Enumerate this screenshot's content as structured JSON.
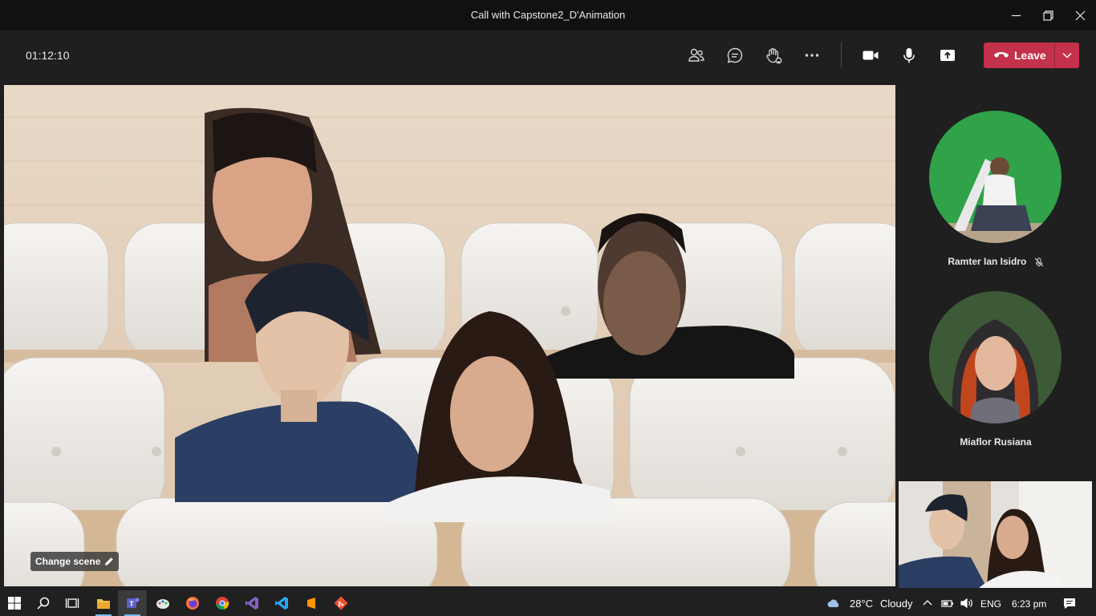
{
  "window": {
    "title": "Call with Capstone2_D'Animation",
    "controls": [
      "minimize-icon",
      "restore-icon",
      "close-icon"
    ]
  },
  "toolbar": {
    "timer": "01:12:10",
    "buttons": [
      "people-icon",
      "chat-icon",
      "raise-hand-icon",
      "more-options-icon",
      "camera-icon",
      "microphone-icon",
      "share-screen-icon"
    ],
    "leave_label": "Leave",
    "leave_color": "#c4314b"
  },
  "stage": {
    "change_scene_label": "Change scene"
  },
  "participants": [
    {
      "name": "Ramter Ian Isidro",
      "muted": true
    },
    {
      "name": "Miaflor Rusiana",
      "muted": false
    }
  ],
  "taskbar": {
    "apps": [
      "windows-start-icon",
      "search-icon",
      "task-view-icon",
      "file-explorer-icon",
      "teams-icon",
      "paint-icon",
      "firefox-icon",
      "chrome-icon",
      "visual-studio-icon",
      "vscode-icon",
      "sublime-text-icon",
      "git-icon"
    ],
    "weather_temp": "28°C",
    "weather_desc": "Cloudy",
    "language": "ENG",
    "time": "6:23 pm"
  }
}
